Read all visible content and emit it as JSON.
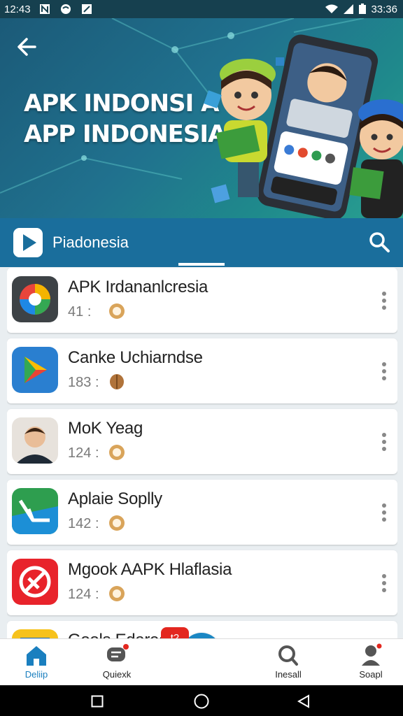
{
  "status_bar": {
    "time": "12:43",
    "clock_right": "33:36",
    "icons": [
      "signal-n-icon",
      "mail-icon",
      "checkbox-icon",
      "wifi-icon",
      "cell-signal-icon",
      "battery-icon"
    ]
  },
  "hero": {
    "title_line1": "APK INDONSI A",
    "title_line2": "APP INDONESIA"
  },
  "app_bar": {
    "name": "Piadonesia"
  },
  "apps": [
    {
      "title": "APK Irdananlcresia",
      "count": "41",
      "sep": ":",
      "icon": "chrome-like-icon"
    },
    {
      "title": "Canke Uchiarndse",
      "count": "183",
      "sep": ":",
      "icon": "play-store-icon"
    },
    {
      "title": "MoK Yeag",
      "count": "124",
      "sep": ":",
      "icon": "avatar-photo"
    },
    {
      "title": "Aplaie Soplly",
      "count": "142",
      "sep": ":",
      "icon": "green-app-icon"
    },
    {
      "title": "Mgook AAPK Hlaflasia",
      "count": "124",
      "sep": ":",
      "icon": "red-app-icon"
    },
    {
      "title": "Gools Edared",
      "count": "",
      "sep": "",
      "icon": "yellow-app-icon"
    }
  ],
  "bottom_nav": [
    {
      "label": "Deliip",
      "icon": "home-icon"
    },
    {
      "label": "Quiexk",
      "icon": "chat-icon"
    },
    {
      "label": "Inesall",
      "icon": "search-icon"
    },
    {
      "label": "Soapl",
      "icon": "profile-icon"
    }
  ],
  "fab_badge": "t2",
  "colors": {
    "primary": "#1a6e9c",
    "accent": "#1b87c3",
    "badge": "#e3271f"
  }
}
